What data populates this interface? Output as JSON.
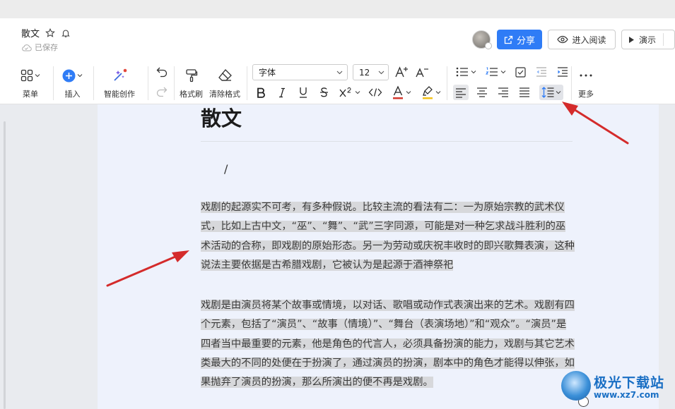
{
  "header": {
    "doc_title": "散文",
    "save_status": "已保存",
    "share_label": "分享",
    "read_mode_label": "进入阅读",
    "present_label": "演示"
  },
  "toolbar": {
    "menu_label": "菜单",
    "insert_label": "插入",
    "ai_create_label": "智能创作",
    "format_painter_label": "格式刷",
    "clear_format_label": "清除格式",
    "font_family": "字体",
    "font_size": "12",
    "more_label": "更多"
  },
  "tooltip": "行距",
  "document": {
    "title": "散文",
    "slash": "/",
    "paragraph1": "戏剧的起源实不可考，有多种假说。比较主流的看法有二：一为原始宗教的武术仪式，比如上古中文，“巫”、“舞”、“武”三字同源，可能是对一种乞求战斗胜利的巫术活动的合称，即戏剧的原始形态。另一为劳动或庆祝丰收时的即兴歌舞表演，这种说法主要依据是古希腊戏剧，它被认为是起源于酒神祭祀",
    "paragraph2": "戏剧是由演员将某个故事或情境，以对话、歌唱或动作式表演出来的艺术。戏剧有四个元素，包括了“演员”、“故事（情境）”、“舞台（表演场地）”和“观众”。“演员”是四者当中最重要的元素，他是角色的代言人，必须具备扮演的能力，戏剧与其它艺术类最大的不同的处便在于扮演了，通过演员的扮演，剧本中的角色才能得以伸张，如果抛弃了演员的扮演，那么所演出的便不再是戏剧。"
  },
  "watermark": {
    "name": "极光下载站",
    "url": "www.xz7.com"
  },
  "colors": {
    "accent": "#2f7cf6",
    "arrow": "#d42b2b",
    "selection": "#d7d8db",
    "page_bg": "#eef2fc"
  }
}
